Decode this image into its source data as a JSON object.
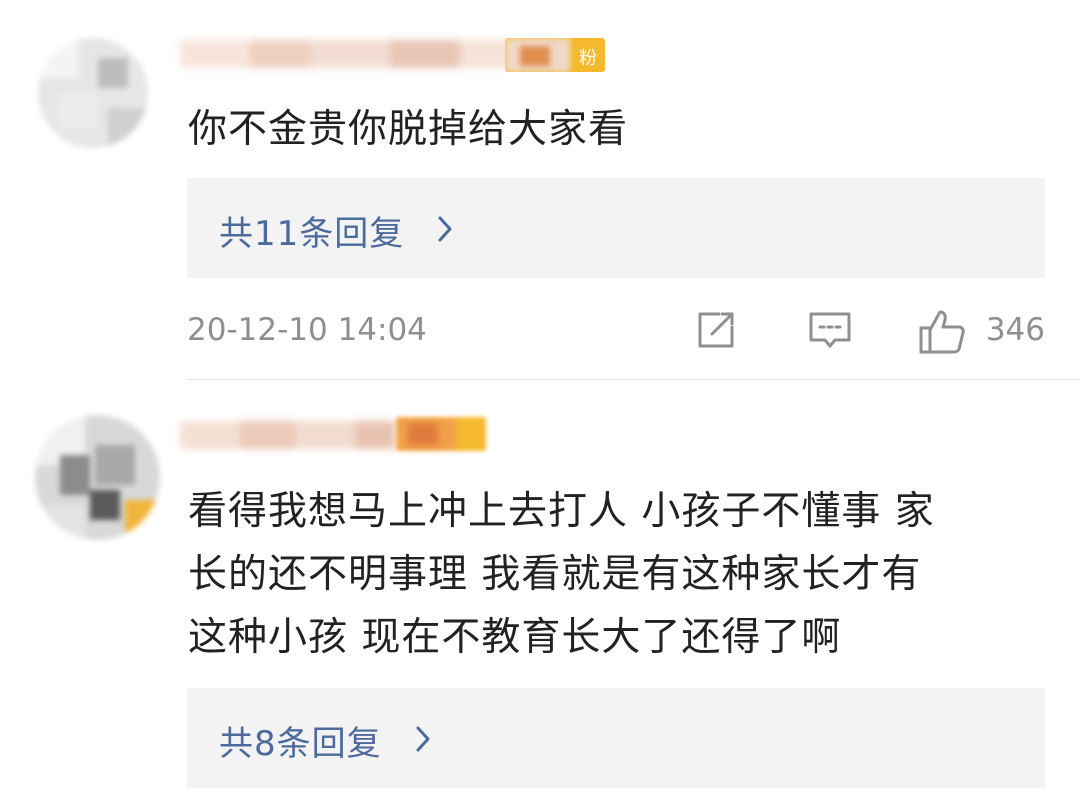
{
  "comments": [
    {
      "badge_text": "粉",
      "text": "你不金贵你脱掉给大家看",
      "reply_label": "共11条回复",
      "timestamp": "20-12-10 14:04",
      "like_count": "346"
    },
    {
      "text_lines": [
        "看得我想马上冲上去打人 小孩子不懂事 家",
        "长的还不明事理 我看就是有这种家长才有",
        "这种小孩 现在不教育长大了还得了啊"
      ],
      "reply_label": "共8条回复"
    }
  ],
  "colors": {
    "reply_link": "#4c6a9c",
    "meta_text": "#8f8f8f",
    "badge": "#f5b92e"
  }
}
